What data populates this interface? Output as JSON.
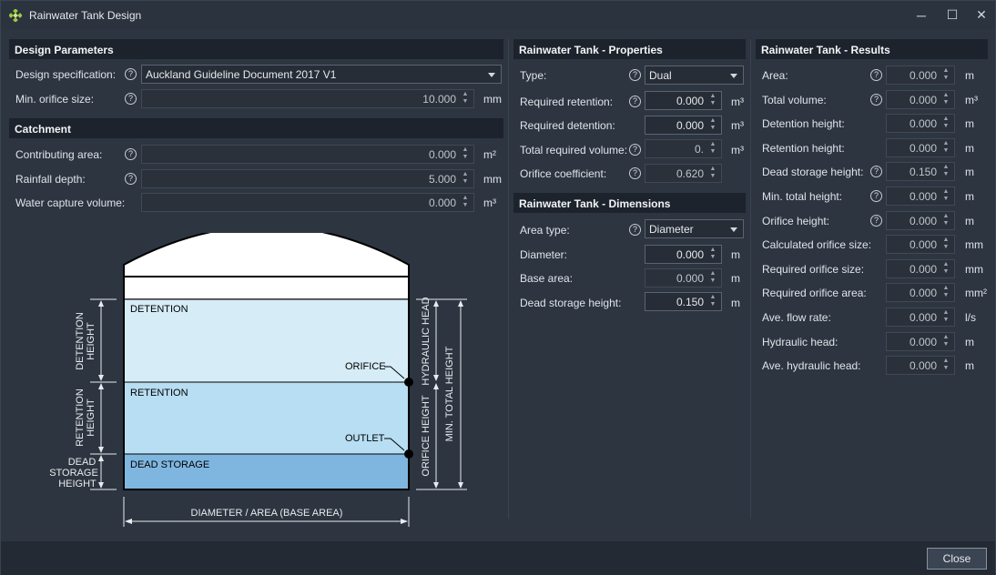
{
  "window": {
    "title": "Rainwater Tank Design",
    "controls": [
      "─",
      "☐",
      "✕"
    ]
  },
  "design": {
    "header": "Design Parameters",
    "spec_label": "Design specification:",
    "spec_value": "Auckland Guideline Document 2017 V1",
    "orifice_label": "Min. orifice size:",
    "orifice_value": "10.000",
    "orifice_unit": "mm"
  },
  "catchment": {
    "header": "Catchment",
    "rows": [
      {
        "label": "Contributing area:",
        "value": "0.000",
        "unit": "m²"
      },
      {
        "label": "Rainfall depth:",
        "value": "5.000",
        "unit": "mm"
      },
      {
        "label": "Water capture volume:",
        "value": "0.000",
        "unit": "m³"
      }
    ]
  },
  "properties": {
    "header": "Rainwater Tank - Properties",
    "type_label": "Type:",
    "type_value": "Dual",
    "rows": [
      {
        "label": "Required retention:",
        "value": "0.000",
        "unit": "m³"
      },
      {
        "label": "Required detention:",
        "value": "0.000",
        "unit": "m³"
      },
      {
        "label": "Total required volume:",
        "value": "0.",
        "unit": "m³"
      },
      {
        "label": "Orifice coefficient:",
        "value": "0.620",
        "unit": ""
      }
    ]
  },
  "dimensions": {
    "header": "Rainwater Tank - Dimensions",
    "area_type_label": "Area type:",
    "area_type_value": "Diameter",
    "rows": [
      {
        "label": "Diameter:",
        "value": "0.000",
        "unit": "m"
      },
      {
        "label": "Base area:",
        "value": "0.000",
        "unit": "m"
      },
      {
        "label": "Dead storage height:",
        "value": "0.150",
        "unit": "m"
      }
    ]
  },
  "results": {
    "header": "Rainwater Tank - Results",
    "rows": [
      {
        "label": "Area:",
        "value": "0.000",
        "unit": "m"
      },
      {
        "label": "Total volume:",
        "value": "0.000",
        "unit": "m³"
      },
      {
        "label": "Detention height:",
        "value": "0.000",
        "unit": "m"
      },
      {
        "label": "Retention height:",
        "value": "0.000",
        "unit": "m"
      },
      {
        "label": "Dead storage height:",
        "value": "0.150",
        "unit": "m"
      },
      {
        "label": "Min. total height:",
        "value": "0.000",
        "unit": "m"
      },
      {
        "label": "Orifice height:",
        "value": "0.000",
        "unit": "m"
      },
      {
        "label": "Calculated orifice size:",
        "value": "0.000",
        "unit": "mm"
      },
      {
        "label": "Required orifice size:",
        "value": "0.000",
        "unit": "mm"
      },
      {
        "label": "Required orifice area:",
        "value": "0.000",
        "unit": "mm²"
      },
      {
        "label": "Ave. flow rate:",
        "value": "0.000",
        "unit": "l/s"
      },
      {
        "label": "Hydraulic head:",
        "value": "0.000",
        "unit": "m"
      },
      {
        "label": "Ave. hydraulic head:",
        "value": "0.000",
        "unit": "m"
      }
    ]
  },
  "diagram": {
    "detention": "DETENTION",
    "retention": "RETENTION",
    "dead_storage": "DEAD STORAGE",
    "orifice": "ORIFICE",
    "outlet": "OUTLET",
    "detention_height_1": "DETENTION",
    "detention_height_2": "HEIGHT",
    "retention_height_1": "RETENTION",
    "retention_height_2": "HEIGHT",
    "dead_1": "DEAD",
    "dead_2": "STORAGE",
    "dead_3": "HEIGHT",
    "hydraulic_head": "HYDRAULIC HEAD",
    "orifice_height": "ORIFICE HEIGHT",
    "min_total_height": "MIN. TOTAL HEIGHT",
    "diameter": "DIAMETER / AREA (BASE AREA)"
  },
  "footer": {
    "close": "Close"
  },
  "colors": {
    "detention": "#d6edf8",
    "retention": "#b7def2",
    "dead_storage": "#7fb6df",
    "accent_icon": "#9ccc3c"
  }
}
